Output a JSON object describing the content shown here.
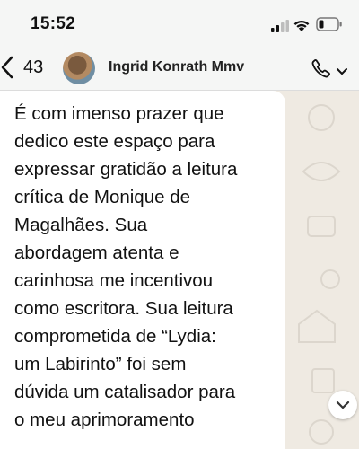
{
  "status_bar": {
    "time": "15:52",
    "icons": [
      "cellular-signal-icon",
      "wifi-icon",
      "battery-icon"
    ]
  },
  "header": {
    "back_icon": "chevron-left-icon",
    "unread_count": "43",
    "contact_name": "Ingrid Konrath Mmv",
    "call_icon": "phone-icon",
    "call_menu_icon": "chevron-down-icon"
  },
  "message": {
    "lines": [
      "É com imenso prazer que",
      "dedico este espaço para",
      "expressar gratidão a leitura",
      "crítica de Monique de",
      "Magalhães. Sua",
      "abordagem atenta e",
      "carinhosa me incentivou",
      "como escritora. Sua leitura",
      "comprometida de “Lydia:",
      "um Labirinto” foi sem",
      "dúvida um catalisador para",
      "o meu aprimoramento"
    ]
  },
  "scroll_down_icon": "chevron-down-icon",
  "colors": {
    "chat_background": "#efeae2",
    "bubble": "#ffffff",
    "header_background": "#f5f6f5"
  }
}
